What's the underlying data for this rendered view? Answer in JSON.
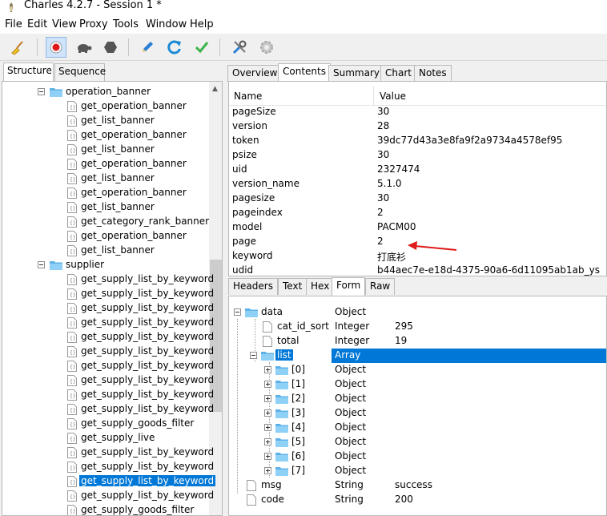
{
  "window": {
    "title": "Charles 4.2.7 - Session 1 *"
  },
  "menu": [
    "File",
    "Edit",
    "View",
    "Proxy",
    "Tools",
    "Window",
    "Help"
  ],
  "toolbar": {
    "icons": [
      "broom-icon",
      "record-icon",
      "turtle-icon",
      "hexagon-stop-icon",
      "pen-icon",
      "refresh-icon",
      "check-icon",
      "tools-icon",
      "settings-gear-icon"
    ]
  },
  "left_tabs": [
    "Structure",
    "Sequence"
  ],
  "tree": [
    {
      "type": "folder",
      "label": "operation_banner"
    },
    {
      "type": "file",
      "label": "get_operation_banner"
    },
    {
      "type": "file",
      "label": "get_list_banner"
    },
    {
      "type": "file",
      "label": "get_operation_banner"
    },
    {
      "type": "file",
      "label": "get_list_banner"
    },
    {
      "type": "file",
      "label": "get_operation_banner"
    },
    {
      "type": "file",
      "label": "get_list_banner"
    },
    {
      "type": "file",
      "label": "get_operation_banner"
    },
    {
      "type": "file",
      "label": "get_list_banner"
    },
    {
      "type": "file",
      "label": "get_category_rank_banner"
    },
    {
      "type": "file",
      "label": "get_operation_banner"
    },
    {
      "type": "file",
      "label": "get_list_banner"
    },
    {
      "type": "folder",
      "label": "supplier"
    },
    {
      "type": "file",
      "label": "get_supply_list_by_keyword"
    },
    {
      "type": "file",
      "label": "get_supply_list_by_keyword"
    },
    {
      "type": "file",
      "label": "get_supply_list_by_keyword"
    },
    {
      "type": "file",
      "label": "get_supply_list_by_keyword"
    },
    {
      "type": "file",
      "label": "get_supply_list_by_keyword"
    },
    {
      "type": "file",
      "label": "get_supply_list_by_keyword"
    },
    {
      "type": "file",
      "label": "get_supply_list_by_keyword"
    },
    {
      "type": "file",
      "label": "get_supply_list_by_keyword"
    },
    {
      "type": "file",
      "label": "get_supply_list_by_keyword"
    },
    {
      "type": "file",
      "label": "get_supply_list_by_keyword"
    },
    {
      "type": "file",
      "label": "get_supply_goods_filter"
    },
    {
      "type": "file",
      "label": "get_supply_live"
    },
    {
      "type": "file",
      "label": "get_supply_list_by_keyword"
    },
    {
      "type": "file",
      "label": "get_supply_list_by_keyword"
    },
    {
      "type": "file",
      "label": "get_supply_list_by_keyword",
      "selected": true
    },
    {
      "type": "file",
      "label": "get_supply_list_by_keyword"
    },
    {
      "type": "file",
      "label": "get_supply_goods_filter"
    }
  ],
  "right_tabs": [
    "Overview",
    "Contents",
    "Summary",
    "Chart",
    "Notes"
  ],
  "params_header": {
    "name": "Name",
    "value": "Value"
  },
  "params": [
    {
      "name": "pageSize",
      "value": "30"
    },
    {
      "name": "version",
      "value": "28"
    },
    {
      "name": "token",
      "value": "39dc77d43a3e8fa9f2a9734a4578ef95"
    },
    {
      "name": "psize",
      "value": "30"
    },
    {
      "name": "uid",
      "value": "2327474"
    },
    {
      "name": "version_name",
      "value": "5.1.0"
    },
    {
      "name": "pagesize",
      "value": "30"
    },
    {
      "name": "pageindex",
      "value": "2"
    },
    {
      "name": "model",
      "value": "PACM00"
    },
    {
      "name": "page",
      "value": "2"
    },
    {
      "name": "keyword",
      "value": "打底衫"
    },
    {
      "name": "udid",
      "value": "b44aec7e-e18d-4375-90a6-6d11095ab1ab_ys"
    }
  ],
  "bottom_tabs": [
    "Headers",
    "Text",
    "Hex",
    "Form",
    "Raw"
  ],
  "json_tree": [
    {
      "name": "data",
      "type": "Object",
      "value": ""
    },
    {
      "name": "cat_id_sort",
      "type": "Integer",
      "value": "295"
    },
    {
      "name": "total",
      "type": "Integer",
      "value": "19"
    },
    {
      "name": "list",
      "type": "Array",
      "value": ""
    },
    {
      "name": "[0]",
      "type": "Object",
      "value": ""
    },
    {
      "name": "[1]",
      "type": "Object",
      "value": ""
    },
    {
      "name": "[2]",
      "type": "Object",
      "value": ""
    },
    {
      "name": "[3]",
      "type": "Object",
      "value": ""
    },
    {
      "name": "[4]",
      "type": "Object",
      "value": ""
    },
    {
      "name": "[5]",
      "type": "Object",
      "value": ""
    },
    {
      "name": "[6]",
      "type": "Object",
      "value": ""
    },
    {
      "name": "[7]",
      "type": "Object",
      "value": ""
    },
    {
      "name": "msg",
      "type": "String",
      "value": "success"
    },
    {
      "name": "code",
      "type": "String",
      "value": "200"
    }
  ],
  "colors": {
    "selection": "#0078d7",
    "arrow": "#e0191b"
  }
}
